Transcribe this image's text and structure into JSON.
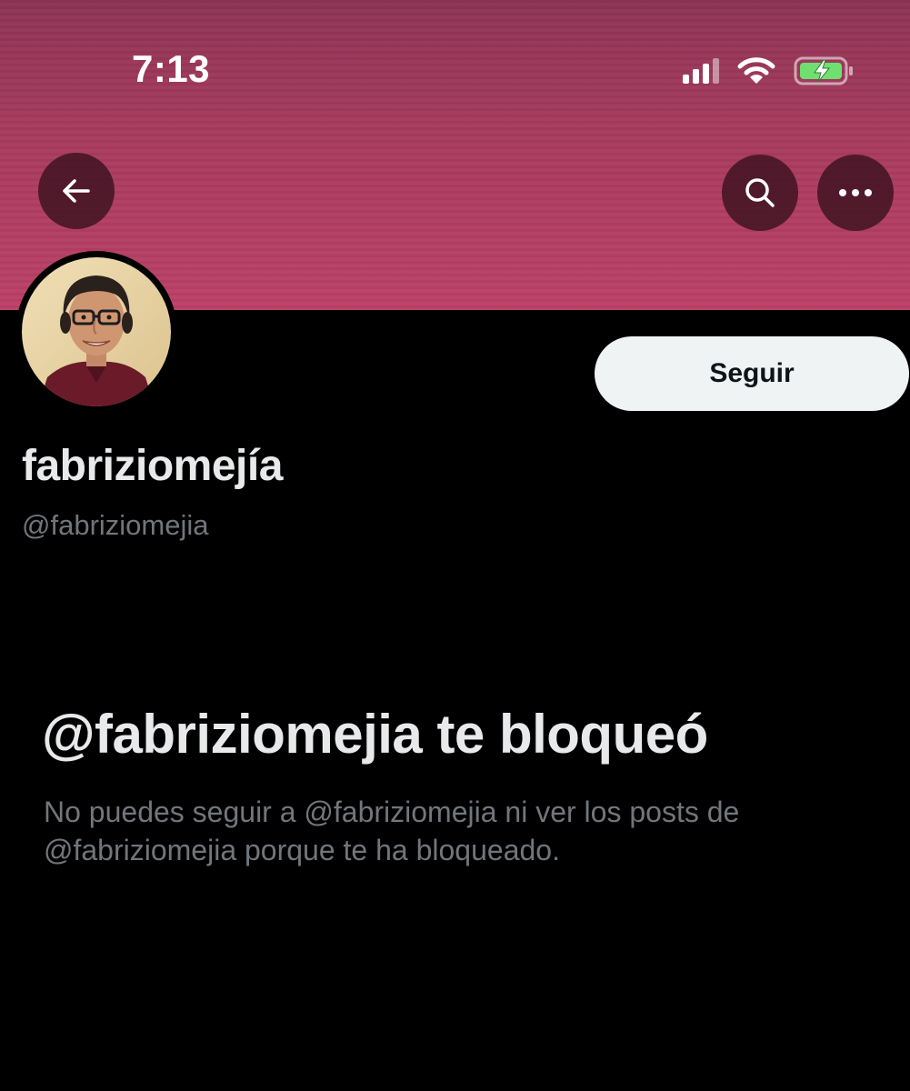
{
  "status_bar": {
    "time": "7:13",
    "icons": [
      "cellular-signal-icon",
      "wifi-icon",
      "battery-charging-icon"
    ]
  },
  "header": {
    "banner_color": "#b33e64",
    "buttons": [
      "back-arrow-icon",
      "search-icon",
      "more-options-icon"
    ]
  },
  "profile": {
    "display_name": "fabriziomejía",
    "handle": "@fabriziomejia",
    "follow_label": "Seguir"
  },
  "blocked": {
    "title": "@fabriziomejia te bloqueó",
    "description": "No puedes seguir a @fabriziomejia ni ver los posts de @fabriziomejia porque te ha bloqueado."
  },
  "colors": {
    "background": "#000000",
    "primary_text": "#e7e9ea",
    "secondary_text": "#71767b",
    "button_background": "#eff3f4",
    "button_text": "#0f1419"
  }
}
